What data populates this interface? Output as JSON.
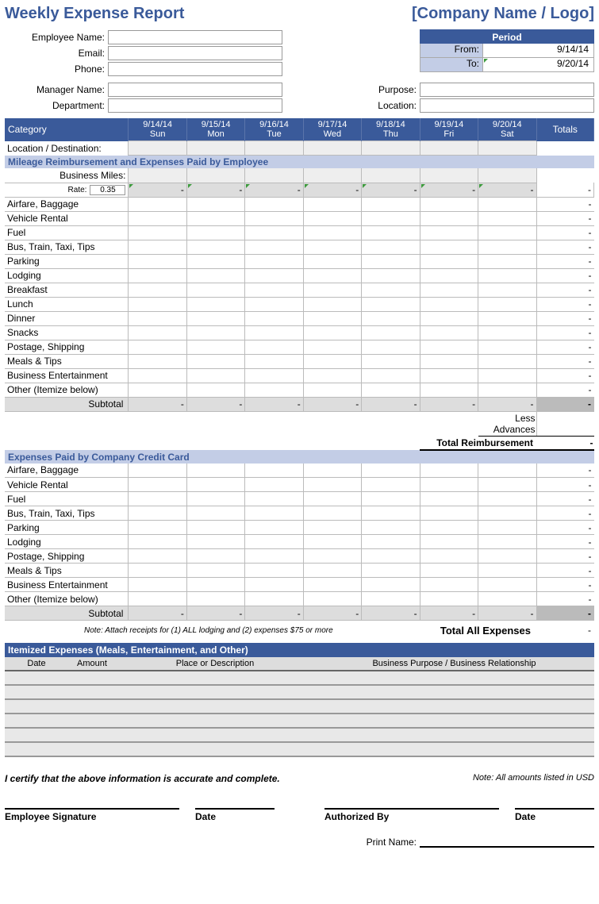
{
  "title": "Weekly Expense Report",
  "company": "[Company Name / Logo]",
  "info": {
    "employee_name_label": "Employee Name:",
    "email_label": "Email:",
    "phone_label": "Phone:",
    "manager_name_label": "Manager Name:",
    "department_label": "Department:",
    "purpose_label": "Purpose:",
    "location_label": "Location:"
  },
  "period": {
    "header": "Period",
    "from_label": "From:",
    "to_label": "To:",
    "from_value": "9/14/14",
    "to_value": "9/20/14"
  },
  "columns": {
    "category": "Category",
    "totals": "Totals",
    "days": [
      {
        "date": "9/14/14",
        "name": "Sun"
      },
      {
        "date": "9/15/14",
        "name": "Mon"
      },
      {
        "date": "9/16/14",
        "name": "Tue"
      },
      {
        "date": "9/17/14",
        "name": "Wed"
      },
      {
        "date": "9/18/14",
        "name": "Thu"
      },
      {
        "date": "9/19/14",
        "name": "Fri"
      },
      {
        "date": "9/20/14",
        "name": "Sat"
      }
    ]
  },
  "location_row_label": "Location / Destination:",
  "section1": {
    "title": "Mileage Reimbursement and Expenses Paid by Employee",
    "business_miles": "Business Miles:",
    "rate_label": "Rate:",
    "rate_value": "0.35",
    "categories": [
      "Airfare, Baggage",
      "Vehicle Rental",
      "Fuel",
      "Bus, Train, Taxi, Tips",
      "Parking",
      "Lodging",
      "Breakfast",
      "Lunch",
      "Dinner",
      "Snacks",
      "Postage, Shipping",
      "Meals & Tips",
      "Business Entertainment",
      "Other (Itemize below)"
    ],
    "subtotal_label": "Subtotal",
    "less_advances": "Less Advances",
    "total_reimbursement": "Total Reimbursement"
  },
  "section2": {
    "title": "Expenses Paid by Company Credit Card",
    "categories": [
      "Airfare, Baggage",
      "Vehicle Rental",
      "Fuel",
      "Bus, Train, Taxi, Tips",
      "Parking",
      "Lodging",
      "Postage, Shipping",
      "Meals & Tips",
      "Business Entertainment",
      "Other (Itemize below)"
    ],
    "subtotal_label": "Subtotal"
  },
  "receipts_note": "Note:  Attach receipts for (1) ALL lodging and (2) expenses $75 or more",
  "total_all_label": "Total All Expenses",
  "itemized": {
    "title": "Itemized Expenses (Meals, Entertainment, and Other)",
    "cols": {
      "date": "Date",
      "amount": "Amount",
      "place": "Place or Description",
      "purpose": "Business Purpose / Business Relationship"
    }
  },
  "certify": "I certify that the above information is accurate and complete.",
  "usd_note": "Note: All amounts listed in USD",
  "sig": {
    "emp": "Employee Signature",
    "date": "Date",
    "auth": "Authorized By",
    "date2": "Date",
    "print": "Print Name:"
  },
  "dash": "-"
}
